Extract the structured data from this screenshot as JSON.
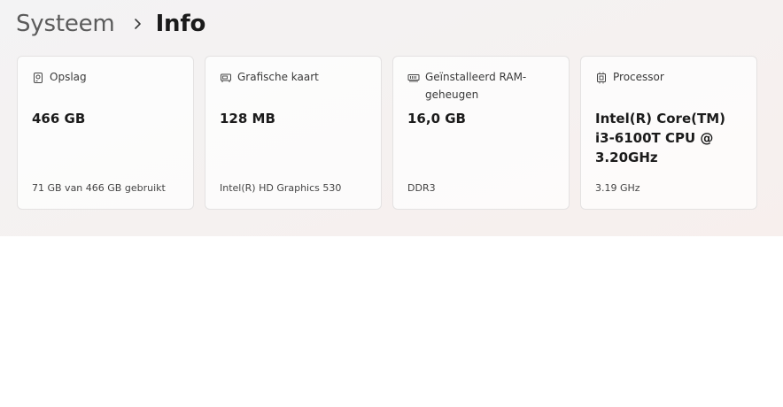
{
  "breadcrumb": {
    "parent": "Systeem",
    "separator_icon": "chevron-right-icon",
    "current": "Info"
  },
  "cards": [
    {
      "icon": "storage-drive-icon",
      "label": "Opslag",
      "value": "466 GB",
      "detail": "71 GB van 466 GB gebruikt"
    },
    {
      "icon": "graphics-card-icon",
      "label": "Grafische kaart",
      "value": "128 MB",
      "detail": "Intel(R) HD Graphics 530"
    },
    {
      "icon": "memory-ram-icon",
      "label": "Geïnstalleerd RAM-geheugen",
      "value": "16,0 GB",
      "detail": "DDR3"
    },
    {
      "icon": "processor-chip-icon",
      "label": "Processor",
      "value": "Intel(R) Core(TM) i3-6100T CPU @ 3.20GHz",
      "detail": "3.19 GHz"
    }
  ],
  "colors": {
    "top_area_background": "#f4f1f0",
    "card_background": "#fbfbfb",
    "card_border": "#e4e2e2",
    "text_primary": "#1b1b1b",
    "text_secondary": "#5b5b5b"
  }
}
